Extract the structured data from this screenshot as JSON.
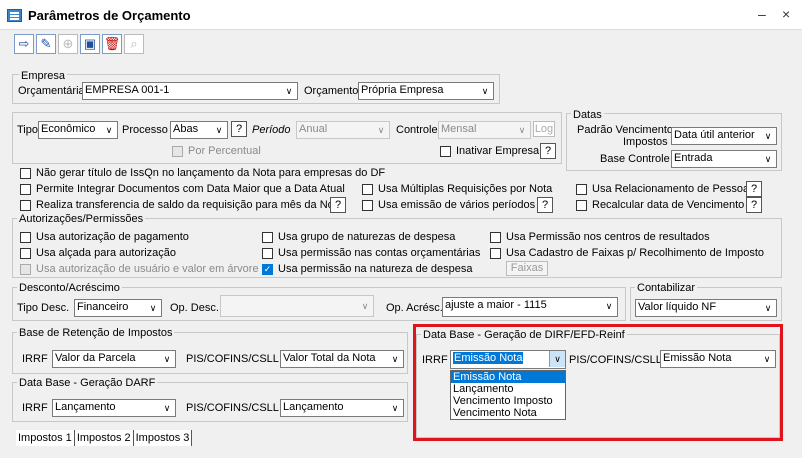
{
  "window": {
    "title": "Parâmetros de Orçamento",
    "minimize": "–",
    "close": "×"
  },
  "empresa": {
    "legend": "Empresa",
    "orcamentaria_label": "Orçamentária",
    "orcamentaria_value": "EMPRESA 001-1",
    "orcamento_label": "Orçamento",
    "orcamento_value": "Própria Empresa"
  },
  "tipo": {
    "tipo_label": "Tipo",
    "tipo_value": "Econômico",
    "processo_label": "Processo",
    "processo_value": "Abas",
    "periodo_label": "Período",
    "periodo_value": "Anual",
    "controle_label": "Controle",
    "controle_value": "Mensal",
    "log_label": "Log",
    "por_percentual": "Por Percentual",
    "inativar_empresa": "Inativar Empresa",
    "help": "?"
  },
  "datas": {
    "legend": "Datas",
    "padrao_label_1": "Padrão Vencimento",
    "padrao_label_2": "Impostos",
    "padrao_value": "Data útil anterior",
    "base_controle_label": "Base Controle",
    "base_controle_value": "Entrada"
  },
  "options": {
    "nao_gerar": "Não gerar título de IssQn no lançamento da Nota para empresas do DF",
    "permite_integrar": "Permite Integrar Documentos com Data Maior que a Data Atual",
    "realiza_transferencia": "Realiza transferencia de saldo da requisição para mês da Nota",
    "multiplas_requisicoes": "Usa Múltiplas Requisições por Nota",
    "emissao_varios": "Usa emissão de vários períodos",
    "relacionamento": "Usa Relacionamento de Pessoa",
    "recalcular": "Recalcular data de Vencimento"
  },
  "autorizacoes": {
    "legend": "Autorizações/Permissões",
    "autorizacao_pagamento": "Usa autorização de pagamento",
    "alcada_aprovacao": "Usa alçada para autorização",
    "autorizacao_usuario": "Usa autorização de usuário e valor em árvore",
    "grupo_naturezas": "Usa grupo de naturezas de despesa",
    "permissao_contas": "Usa permissão nas contas orçamentárias",
    "permissao_natureza": "Usa permissão na natureza de despesa",
    "permissao_centros": "Usa Permissão nos centros de resultados",
    "cadastro_faixas": "Usa Cadastro de Faixas p/ Recolhimento de Imposto",
    "faixas_button": "Faixas"
  },
  "desconto": {
    "legend": "Desconto/Acréscimo",
    "tipo_desc_label": "Tipo Desc.",
    "tipo_desc_value": "Financeiro",
    "op_desc_label": "Op. Desc.",
    "op_desc_value": "",
    "op_acresc_label": "Op. Acrésc.",
    "op_acresc_value": "ajuste a maior - 1115"
  },
  "contabilizar": {
    "legend": "Contabilizar",
    "value": "Valor líquido NF"
  },
  "retencao": {
    "legend": "Base de Retenção de Impostos",
    "irrf_label": "IRRF",
    "irrf_value": "Valor da Parcela",
    "pis_label": "PIS/COFINS/CSLL",
    "pis_value": "Valor Total da Nota"
  },
  "darf": {
    "legend": "Data Base - Geração DARF",
    "irrf_label": "IRRF",
    "irrf_value": "Lançamento",
    "pis_label": "PIS/COFINS/CSLL",
    "pis_value": "Lançamento"
  },
  "dirf": {
    "legend": "Data Base - Geração de DIRF/EFD-Reinf",
    "irrf_label": "IRRF",
    "irrf_value": "Emissão Nota",
    "pis_label": "PIS/COFINS/CSLL",
    "pis_value": "Emissão Nota",
    "dropdown_options": [
      "Emissão Nota",
      "Lançamento",
      "Vencimento Imposto",
      "Vencimento Nota"
    ]
  },
  "tabs": [
    "Impostos 1",
    "Impostos 2",
    "Impostos 3"
  ],
  "colors": {
    "highlight": "#0078d7",
    "annotation_red": "#e0141c"
  }
}
